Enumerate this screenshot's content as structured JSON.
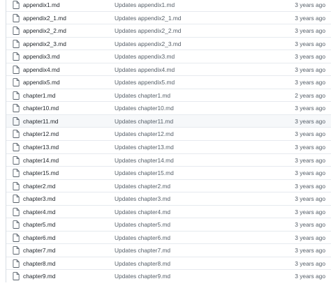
{
  "files": [
    {
      "name": "appendix1.md",
      "message": "Updates appendix1.md",
      "age": "3 years ago"
    },
    {
      "name": "appendix2_1.md",
      "message": "Updates appendix2_1.md",
      "age": "3 years ago"
    },
    {
      "name": "appendix2_2.md",
      "message": "Updates appendix2_2.md",
      "age": "3 years ago"
    },
    {
      "name": "appendix2_3.md",
      "message": "Updates appendix2_3.md",
      "age": "3 years ago"
    },
    {
      "name": "appendix3.md",
      "message": "Updates appendix3.md",
      "age": "3 years ago"
    },
    {
      "name": "appendix4.md",
      "message": "Updates appendix4.md",
      "age": "3 years ago"
    },
    {
      "name": "appendix5.md",
      "message": "Updates appendix5.md",
      "age": "3 years ago"
    },
    {
      "name": "chapter1.md",
      "message": "Updates chapter1.md",
      "age": "2 years ago"
    },
    {
      "name": "chapter10.md",
      "message": "Updates chapter10.md",
      "age": "3 years ago"
    },
    {
      "name": "chapter11.md",
      "message": "Updates chapter11.md",
      "age": "3 years ago"
    },
    {
      "name": "chapter12.md",
      "message": "Updates chapter12.md",
      "age": "3 years ago"
    },
    {
      "name": "chapter13.md",
      "message": "Updates chapter13.md",
      "age": "3 years ago"
    },
    {
      "name": "chapter14.md",
      "message": "Updates chapter14.md",
      "age": "3 years ago"
    },
    {
      "name": "chapter15.md",
      "message": "Updates chapter15.md",
      "age": "3 years ago"
    },
    {
      "name": "chapter2.md",
      "message": "Updates chapter2.md",
      "age": "3 years ago"
    },
    {
      "name": "chapter3.md",
      "message": "Updates chapter3.md",
      "age": "3 years ago"
    },
    {
      "name": "chapter4.md",
      "message": "Updates chapter4.md",
      "age": "3 years ago"
    },
    {
      "name": "chapter5.md",
      "message": "Updates chapter5.md",
      "age": "3 years ago"
    },
    {
      "name": "chapter6.md",
      "message": "Updates chapter6.md",
      "age": "3 years ago"
    },
    {
      "name": "chapter7.md",
      "message": "Updates chapter7.md",
      "age": "3 years ago"
    },
    {
      "name": "chapter8.md",
      "message": "Updates chapter8.md",
      "age": "3 years ago"
    },
    {
      "name": "chapter9.md",
      "message": "Updates chapter9.md",
      "age": "3 years ago"
    }
  ],
  "hovered_file": "chapter11.md",
  "icons": {
    "file": "file-icon"
  },
  "colors": {
    "file_name": "#24292f",
    "muted_text": "#57606a",
    "icon": "#57606a",
    "row_border": "#e6eaef",
    "row_hover": "#f6f8fa"
  }
}
